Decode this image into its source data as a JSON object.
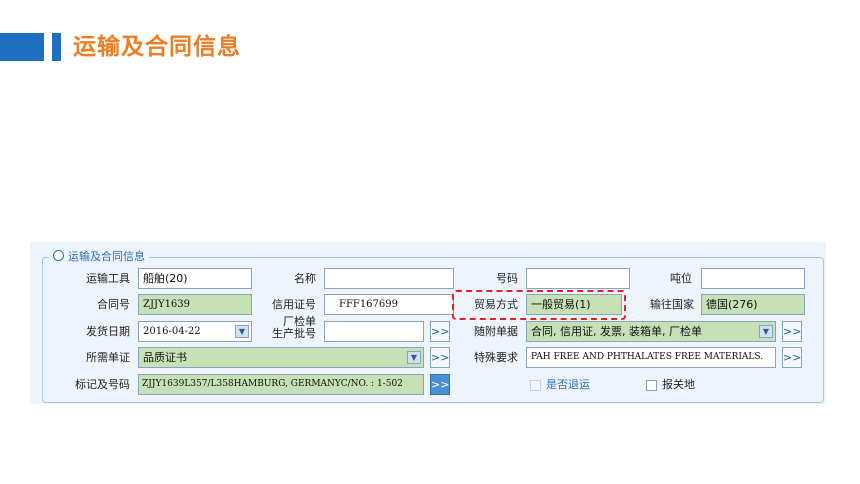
{
  "header": {
    "title": "运输及合同信息"
  },
  "form": {
    "legend": "运输及合同信息",
    "labels": {
      "transport_tool": "运输工具",
      "name": "名称",
      "number": "号码",
      "tonnage": "吨位",
      "contract_no": "合同号",
      "lc_no": "信用证号",
      "trade_mode": "贸易方式",
      "dest_country": "输往国家",
      "ship_date": "发货日期",
      "inspection_line1": "厂检单",
      "inspection_line2": "生产批号",
      "attached_docs": "随附单据",
      "required_cert": "所需单证",
      "special_req": "特殊要求",
      "marks": "标记及号码",
      "is_return": "是否退运",
      "customs_place": "报关地"
    },
    "values": {
      "transport_tool": "船舶(20)",
      "name": "",
      "number": "",
      "tonnage": "",
      "contract_no": "ZJJY1639",
      "lc_no": "FFF167699",
      "trade_mode": "一般贸易(1)",
      "dest_country": "德国(276)",
      "ship_date": "2016-04-22",
      "inspection": "",
      "attached_docs": "合同, 信用证, 发票, 装箱单, 厂检单",
      "required_cert": "品质证书",
      "special_req": "PAH FREE AND PHTHALATES FREE MATERIALS.",
      "marks": "ZJJY1639L357/L358HAMBURG, GERMANYC/NO. : 1-502"
    },
    "buttons": {
      "more": ">>"
    }
  },
  "colors": {
    "accent": "#ec7d22",
    "brand": "#1f6fc0",
    "highlight": "#e02424"
  }
}
